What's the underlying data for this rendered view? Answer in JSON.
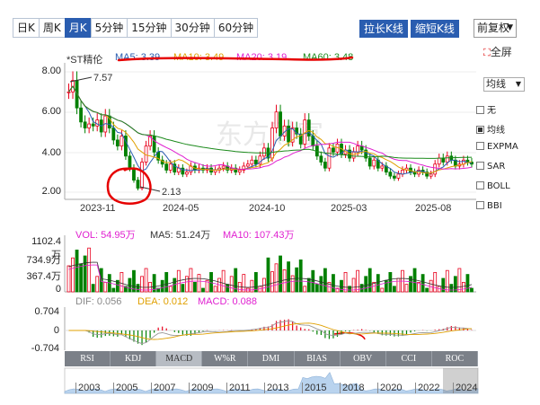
{
  "periods": [
    "日K",
    "周K",
    "月K",
    "5分钟",
    "15分钟",
    "30分钟",
    "60分钟"
  ],
  "active_period": "月K",
  "toolbar": {
    "stretch": "拉长K线",
    "shrink": "缩短K线",
    "adjust": "前复权",
    "fullscreen": "全屏"
  },
  "stock_name": "*ST精伦",
  "ma": {
    "ma5": "MA5: 3.39",
    "ma10": "MA10: 3.49",
    "ma20": "MA20: 3.19",
    "ma60": "MA60: 3.48"
  },
  "colors": {
    "up": "#e8001c",
    "down": "#008000",
    "ma5": "#2a5db0",
    "ma10": "#e0a000",
    "ma20": "#e020d0",
    "ma60": "#1c8a1c",
    "annotation": "#e60000"
  },
  "price_axis": [
    "8.00",
    "6.00",
    "4.00",
    "2.00"
  ],
  "price_high": "7.57",
  "price_low": "2.13",
  "x_axis": [
    "2023-11",
    "2024-05",
    "2024-10",
    "2025-03",
    "2025-08"
  ],
  "indicator_menu": {
    "title": "均线",
    "items": [
      {
        "label": "无",
        "checked": false
      },
      {
        "label": "均线",
        "checked": true
      },
      {
        "label": "EXPMA",
        "checked": false
      },
      {
        "label": "SAR",
        "checked": false
      },
      {
        "label": "BOLL",
        "checked": false
      },
      {
        "label": "BBI",
        "checked": false
      }
    ]
  },
  "volume": {
    "vol": "VOL: 54.95万",
    "ma5": "MA5: 51.24万",
    "ma10": "MA10: 107.43万",
    "axis": [
      "1102.4万",
      "734.9万",
      "367.4万",
      "0"
    ]
  },
  "macd": {
    "dif": "DIF: 0.056",
    "dea": "DEA: 0.012",
    "macd": "MACD: 0.088",
    "axis": [
      "0.704",
      "0",
      "-0.704"
    ]
  },
  "tabs": [
    "RSI",
    "KDJ",
    "MACD",
    "W%R",
    "DMI",
    "BIAS",
    "OBV",
    "CCI",
    "ROC"
  ],
  "active_tab": "MACD",
  "timeline": [
    "2003",
    "2005",
    "2007",
    "2009",
    "2011",
    "2013",
    "2015",
    "2018",
    "2020",
    "2022",
    "2024"
  ],
  "logo_text": "东方财富"
}
